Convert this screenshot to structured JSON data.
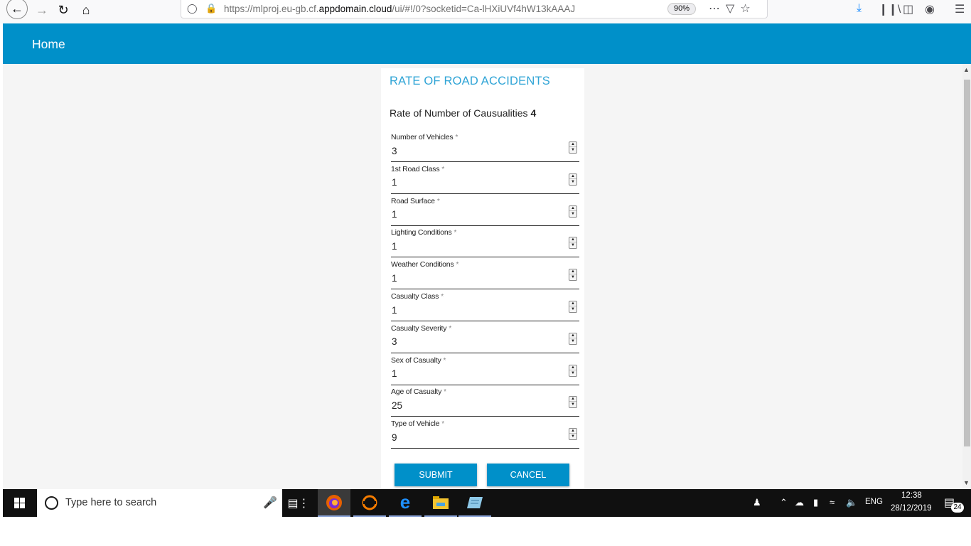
{
  "browser": {
    "url_prefix": "https://mlproj.eu-gb.cf.",
    "url_domain": "appdomain.cloud",
    "url_suffix": "/ui/#!/0?socketid=Ca-lHXiUVf4hW13kAAAJ",
    "zoom": "90%"
  },
  "header": {
    "title": "Home"
  },
  "form": {
    "title": "RATE OF ROAD ACCIDENTS",
    "result_label": "Rate of Number of Causualities",
    "result_value": "4",
    "required_mark": "*",
    "fields": [
      {
        "label": "Number of Vehicles",
        "value": "3"
      },
      {
        "label": "1st Road Class",
        "value": "1"
      },
      {
        "label": "Road Surface",
        "value": "1"
      },
      {
        "label": "Lighting Conditions",
        "value": "1"
      },
      {
        "label": "Weather Conditions",
        "value": "1"
      },
      {
        "label": "Casualty Class",
        "value": "1"
      },
      {
        "label": "Casualty Severity",
        "value": "3"
      },
      {
        "label": "Sex of Casualty",
        "value": "1"
      },
      {
        "label": "Age of Casualty",
        "value": "25"
      },
      {
        "label": "Type of Vehicle",
        "value": "9"
      }
    ],
    "submit_label": "SUBMIT",
    "cancel_label": "CANCEL"
  },
  "taskbar": {
    "search_placeholder": "Type here to search",
    "language": "ENG",
    "time": "12:38",
    "date": "28/12/2019",
    "notification_count": "24"
  },
  "colors": {
    "header": "#0090c9",
    "title": "#2fa4d6",
    "button": "#0090c9"
  }
}
